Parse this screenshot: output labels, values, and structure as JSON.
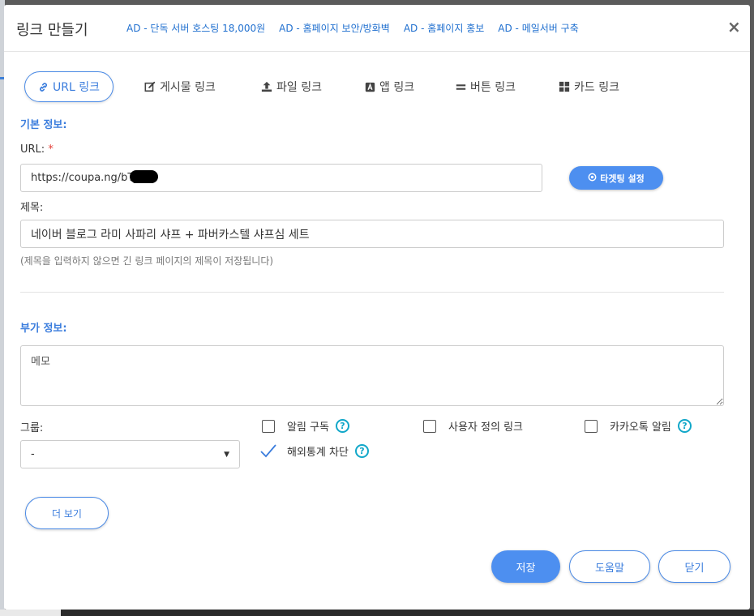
{
  "dialog": {
    "title": "링크 만들기",
    "close_symbol": "×",
    "ads": [
      {
        "label": "AD - 단독 서버 호스팅 18,000원"
      },
      {
        "label": "AD - 홈페이지 보안/방화벽"
      },
      {
        "label": "AD - 홈페이지 홍보"
      },
      {
        "label": "AD - 메일서버 구축"
      }
    ]
  },
  "tabs": [
    {
      "label": "URL 링크",
      "icon": "link-icon",
      "active": true
    },
    {
      "label": "게시물 링크",
      "icon": "edit-icon"
    },
    {
      "label": "파일 링크",
      "icon": "upload-icon"
    },
    {
      "label": "앱 링크",
      "icon": "app-icon"
    },
    {
      "label": "버튼 링크",
      "icon": "button-icon"
    },
    {
      "label": "카드 링크",
      "icon": "grid-icon"
    }
  ],
  "basic": {
    "section_title": "기본 정보:",
    "url_label": "URL:",
    "required_mark": "*",
    "url_value": "https://coupa.ng/bTJ",
    "targeting_button": "타겟팅 설정",
    "title_label": "제목:",
    "title_value": "네이버 블로그 라미 사파리 샤프 + 파버카스텔 샤프심 세트",
    "title_hint": "(제목을 입력하지 않으면 긴 링크 페이지의 제목이 저장됩니다)"
  },
  "extra": {
    "section_title": "부가 정보:",
    "memo_placeholder": "메모",
    "group_label": "그룹:",
    "group_value": "-",
    "options": {
      "alert_subscribe": {
        "label": "알림 구독",
        "checked": false,
        "help": "?"
      },
      "custom_link": {
        "label": "사용자 정의 링크",
        "checked": false
      },
      "kakao_alert": {
        "label": "카카오톡 알림",
        "checked": false,
        "help": "?"
      },
      "block_overseas": {
        "label": "해외통계 차단",
        "checked": true,
        "help": "?"
      }
    }
  },
  "buttons": {
    "more": "더 보기",
    "save": "저장",
    "help": "도움말",
    "close": "닫기"
  },
  "colors": {
    "accent": "#3b7ddd",
    "primary_button": "#4d8ff0",
    "help_icon": "#11a7c9",
    "required": "#e4423b"
  }
}
